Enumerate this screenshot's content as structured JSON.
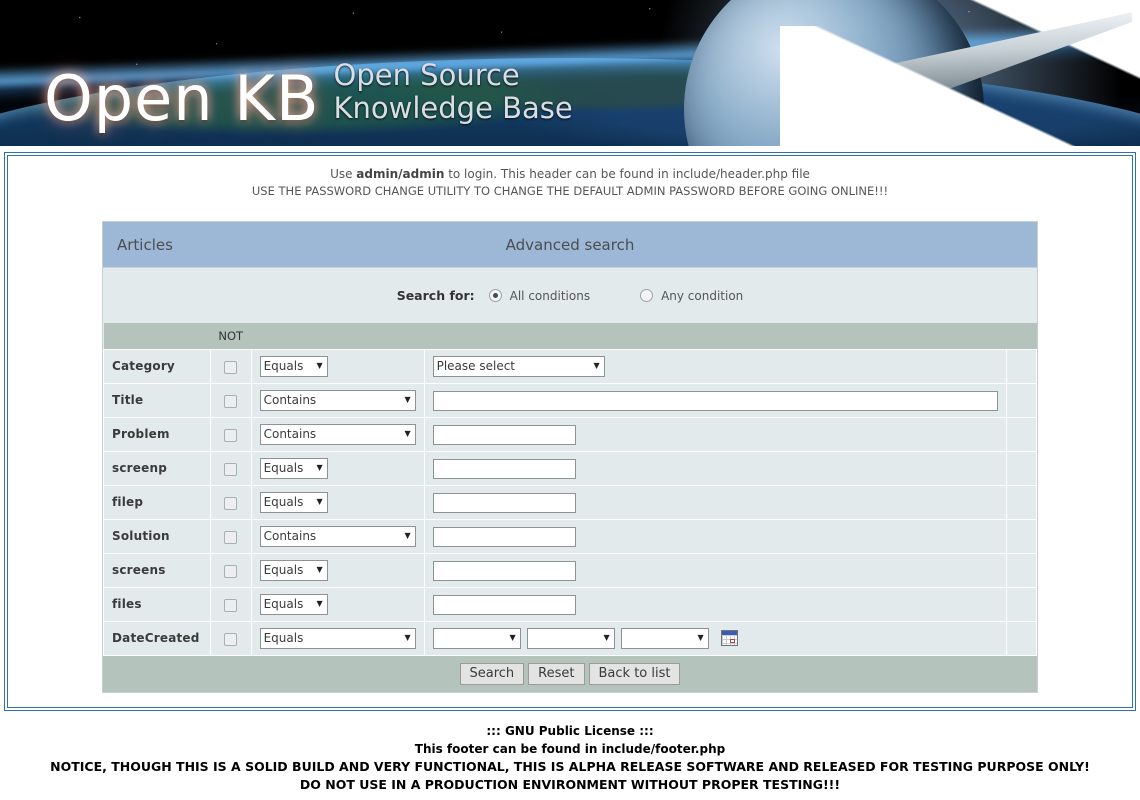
{
  "banner": {
    "logo_main": "Open KB",
    "logo_sub_line1": "Open Source",
    "logo_sub_line2": "Knowledge Base"
  },
  "notice": {
    "line1_pre": "Use ",
    "line1_bold": "admin/admin",
    "line1_post": " to login. This header can be found in include/header.php file",
    "line2": "USE THE PASSWORD CHANGE UTILITY TO CHANGE THE DEFAULT ADMIN PASSWORD BEFORE GOING ONLINE!!!"
  },
  "card": {
    "title_left": "Articles",
    "title_center": "Advanced search",
    "search_for_label": "Search for:",
    "radio_all": "All conditions",
    "radio_any": "Any condition",
    "selected_mode": "All conditions"
  },
  "table": {
    "header_not": "NOT",
    "rows": [
      {
        "field": "Category",
        "not_checked": false,
        "operator": "Equals",
        "op_width": "w-sm",
        "value_type": "select",
        "value": "Please select",
        "value_width": "w-cat"
      },
      {
        "field": "Title",
        "not_checked": false,
        "operator": "Contains",
        "op_width": "w-md",
        "value_type": "text",
        "value": "",
        "value_width": "in-lg"
      },
      {
        "field": "Problem",
        "not_checked": false,
        "operator": "Contains",
        "op_width": "w-md",
        "value_type": "text",
        "value": "",
        "value_width": "in-sm"
      },
      {
        "field": "screenp",
        "not_checked": false,
        "operator": "Equals",
        "op_width": "w-sm",
        "value_type": "text",
        "value": "",
        "value_width": "in-sm"
      },
      {
        "field": "filep",
        "not_checked": false,
        "operator": "Equals",
        "op_width": "w-sm",
        "value_type": "text",
        "value": "",
        "value_width": "in-sm"
      },
      {
        "field": "Solution",
        "not_checked": false,
        "operator": "Contains",
        "op_width": "w-md",
        "value_type": "text",
        "value": "",
        "value_width": "in-sm"
      },
      {
        "field": "screens",
        "not_checked": false,
        "operator": "Equals",
        "op_width": "w-sm",
        "value_type": "text",
        "value": "",
        "value_width": "in-sm"
      },
      {
        "field": "files",
        "not_checked": false,
        "operator": "Equals",
        "op_width": "w-sm",
        "value_type": "text",
        "value": "",
        "value_width": "in-sm"
      },
      {
        "field": "DateCreated",
        "not_checked": false,
        "operator": "Equals",
        "op_width": "w-md",
        "value_type": "date",
        "value": "",
        "value_width": "w-date"
      }
    ],
    "date_parts": [
      "",
      "",
      ""
    ],
    "operator_options": [
      "Equals",
      "Contains"
    ],
    "category_options": [
      "Please select"
    ]
  },
  "buttons": {
    "search": "Search",
    "reset": "Reset",
    "back": "Back to list"
  },
  "footer": {
    "line1": "::: GNU Public License :::",
    "line2": "This footer can be found in include/footer.php",
    "line3": "NOTICE, THOUGH THIS IS A SOLID BUILD AND VERY FUNCTIONAL, THIS IS ALPHA RELEASE SOFTWARE AND RELEASED FOR TESTING PURPOSE ONLY!",
    "line4": "DO NOT USE IN A PRODUCTION ENVIRONMENT WITHOUT PROPER TESTING!!!"
  },
  "colors": {
    "panel_border": "#2d72a8",
    "card_title_bg": "#9cb8d6",
    "card_bg": "#e3eaec",
    "table_header_bg": "#b4c4bc"
  }
}
